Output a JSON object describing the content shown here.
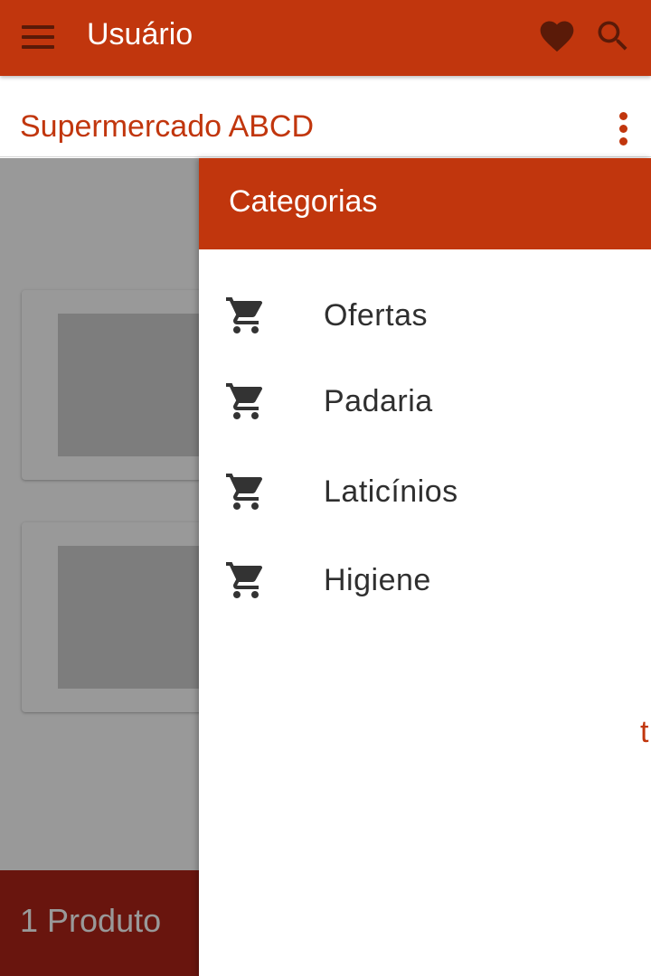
{
  "appbar": {
    "title": "Usuário",
    "menu_icon": "hamburger-menu-icon",
    "favorite_icon": "heart-icon",
    "search_icon": "search-icon",
    "color": "#c1360d"
  },
  "store": {
    "name": "Supermercado ABCD",
    "overflow_icon": "more-vert-icon"
  },
  "drawer": {
    "title": "Categorias",
    "items": [
      {
        "label": "Ofertas",
        "icon": "shopping-cart-icon"
      },
      {
        "label": "Padaria",
        "icon": "shopping-cart-icon"
      },
      {
        "label": "Laticínios",
        "icon": "shopping-cart-icon"
      },
      {
        "label": "Higiene",
        "icon": "shopping-cart-icon"
      }
    ]
  },
  "cart": {
    "count_label": "1 Produto",
    "total_label": "t"
  }
}
